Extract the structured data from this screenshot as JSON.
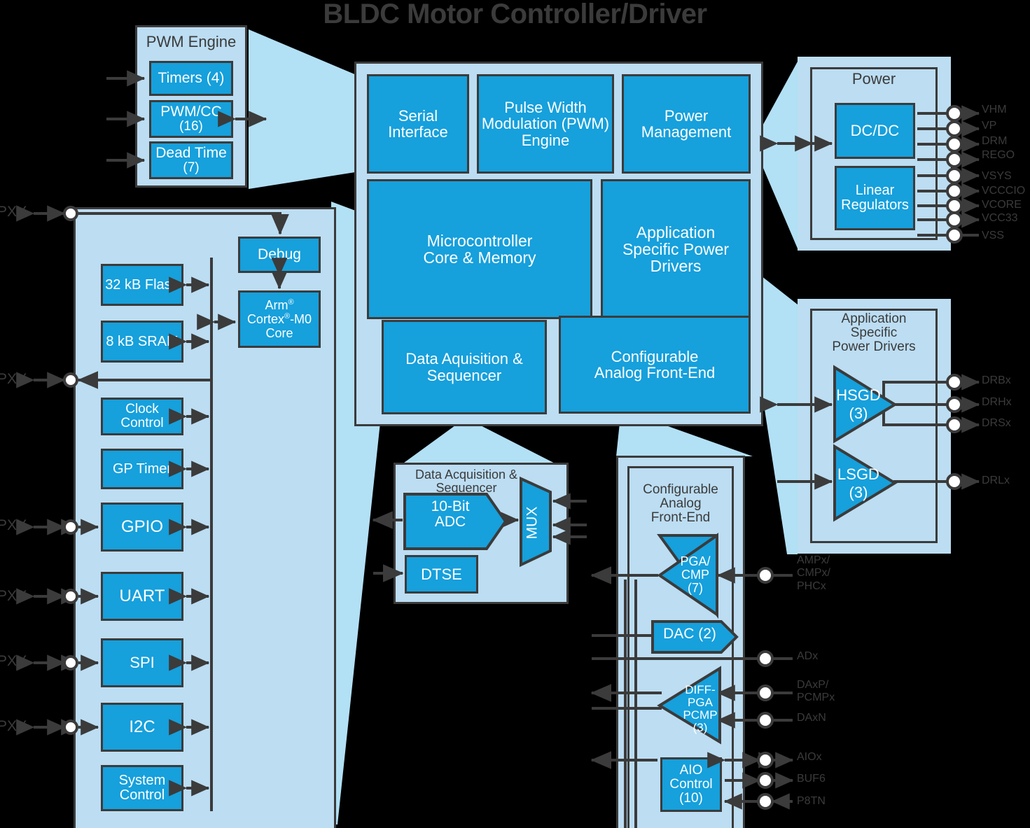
{
  "title": "BLDC Motor Controller/Driver",
  "colors": {
    "blue": "#16a0dc",
    "light_blue": "#bcddf2",
    "callout": "#b2e0f5",
    "outline": "#3b3b3b",
    "background": "#000000",
    "text_light": "#ffffff"
  },
  "pwm_engine": {
    "title": "PWM Engine",
    "blocks": [
      {
        "label": "Timers (4)"
      },
      {
        "label": "PWM/CC\n(16)",
        "line1": "PWM/CC",
        "line2": "(16)"
      },
      {
        "label": "Dead Time\n(7)",
        "line1": "Dead Time",
        "line2": "(7)"
      }
    ]
  },
  "core_chip": {
    "blocks": [
      {
        "id": "serial-interface",
        "line1": "Serial",
        "line2": "Interface"
      },
      {
        "id": "pwm-engine",
        "line1": "Pulse Width",
        "line2": "Modulation (PWM)",
        "line3": "Engine"
      },
      {
        "id": "power-management",
        "line1": "Power",
        "line2": "Management"
      },
      {
        "id": "microcontroller",
        "line1": "Microcontroller",
        "line2": "Core & Memory"
      },
      {
        "id": "app-power-drivers",
        "line1": "Application",
        "line2": "Specific Power",
        "line3": "Drivers"
      },
      {
        "id": "data-acquisition",
        "line1": "Data Aquisition &",
        "line2": "Sequencer"
      },
      {
        "id": "analog-front-end",
        "line1": "Configurable",
        "line2": "Analog Front-End"
      }
    ]
  },
  "mcu_detail": {
    "memory": [
      {
        "label": "32 kB Flash"
      },
      {
        "label": "8 kB SRAM"
      }
    ],
    "debug": "Debug",
    "core": {
      "line1": "Arm",
      "sup1": "®",
      "line2a": "Cortex",
      "sup2": "®",
      "line2b": "-M0",
      "line3": "Core"
    },
    "peripherals": [
      {
        "label": "Clock Control",
        "pin": null
      },
      {
        "label": "GP Timer",
        "pin": null
      },
      {
        "label": "GPIO",
        "pin": "PXY"
      },
      {
        "label": "UART",
        "pin": "PXY"
      },
      {
        "label": "SPI",
        "pin": "PXY"
      },
      {
        "label": "I2C",
        "pin": "PXY"
      },
      {
        "line1": "System",
        "line2": "Control",
        "label": "System Control",
        "pin": null
      }
    ],
    "top_pin": "PXY",
    "second_pin": "PXY"
  },
  "power_detail": {
    "title": "Power",
    "blocks": [
      {
        "label": "DC/DC"
      },
      {
        "line1": "Linear",
        "line2": "Regulators",
        "label": "Linear Regulators"
      }
    ],
    "pins": [
      "VHM",
      "VP",
      "DRM",
      "REGO",
      "VSYS",
      "VCCCIO",
      "VCORE",
      "VCC33",
      "VSS"
    ]
  },
  "power_drivers_detail": {
    "title_l1": "Application",
    "title_l2": "Specific",
    "title_l3": "Power Drivers",
    "amps": [
      {
        "line1": "HSGD",
        "line2": "(3)"
      },
      {
        "line1": "LSGD",
        "line2": "(3)"
      }
    ],
    "pins": [
      "DRBx",
      "DRHx",
      "DRSx",
      "DRLx"
    ]
  },
  "daq_detail": {
    "title_l1": "Data Acquisition &",
    "title_l2": "Sequencer",
    "adc": {
      "line1": "10-Bit",
      "line2": "ADC"
    },
    "dtse": "DTSE",
    "mux": "MUX"
  },
  "afe_detail": {
    "title_l1": "Configurable",
    "title_l2": "Analog",
    "title_l3": "Front-End",
    "pga": {
      "line1": "PGA/",
      "line2": "CMP",
      "line3": "(7)"
    },
    "dac": "DAC (2)",
    "diff": {
      "line1": "DIFF-",
      "line2": "PGA",
      "line3": "PCMP",
      "line4": "(3)"
    },
    "aio": {
      "line1": "AIO",
      "line2": "Control",
      "line3": "(10)"
    },
    "pins": [
      {
        "label": "AMPx/\nCMPx/\nPHCx",
        "l1": "AMPx/",
        "l2": "CMPx/",
        "l3": "PHCx"
      },
      {
        "label": "ADx",
        "l1": "ADx"
      },
      {
        "label": "DAxP/\nPCMPx",
        "l1": "DAxP/",
        "l2": "PCMPx"
      },
      {
        "label": "DAxN",
        "l1": "DAxN"
      },
      {
        "label": "AIOx",
        "l1": "AIOx"
      },
      {
        "label": "BUF6",
        "l1": "BUF6"
      },
      {
        "label": "P8TN",
        "l1": "P8TN"
      }
    ]
  }
}
